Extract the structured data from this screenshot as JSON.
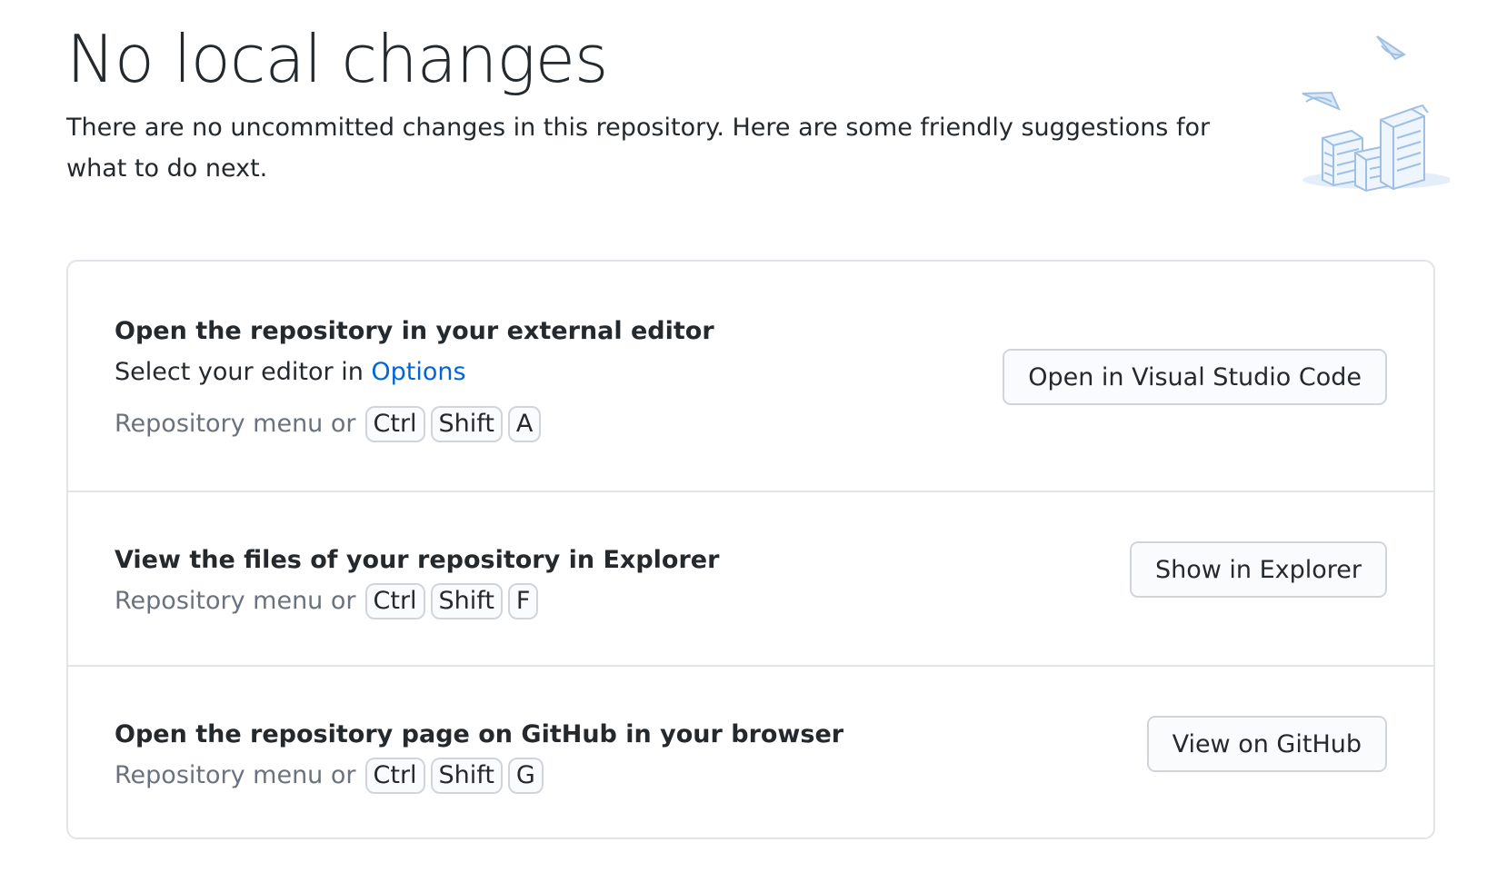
{
  "header": {
    "title": "No local changes",
    "subtitle": "There are no uncommitted changes in this repository. Here are some friendly suggestions for what to do next."
  },
  "illustration": {
    "icon": "papers-stack-illustration",
    "color": "#c8dcf0"
  },
  "suggestions": [
    {
      "title": "Open the repository in your external editor",
      "desc_prefix": "Select your editor in ",
      "desc_link": "Options",
      "shortcut_prefix": "Repository menu or",
      "keys": [
        "Ctrl",
        "Shift",
        "A"
      ],
      "button": "Open in Visual Studio Code"
    },
    {
      "title": "View the files of your repository in Explorer",
      "shortcut_prefix": "Repository menu or",
      "keys": [
        "Ctrl",
        "Shift",
        "F"
      ],
      "button": "Show in Explorer"
    },
    {
      "title": "Open the repository page on GitHub in your browser",
      "shortcut_prefix": "Repository menu or",
      "keys": [
        "Ctrl",
        "Shift",
        "G"
      ],
      "button": "View on GitHub"
    }
  ],
  "colors": {
    "link": "#0366d6",
    "muted": "#6a737d",
    "border": "#e1e4e8",
    "text": "#24292e"
  }
}
